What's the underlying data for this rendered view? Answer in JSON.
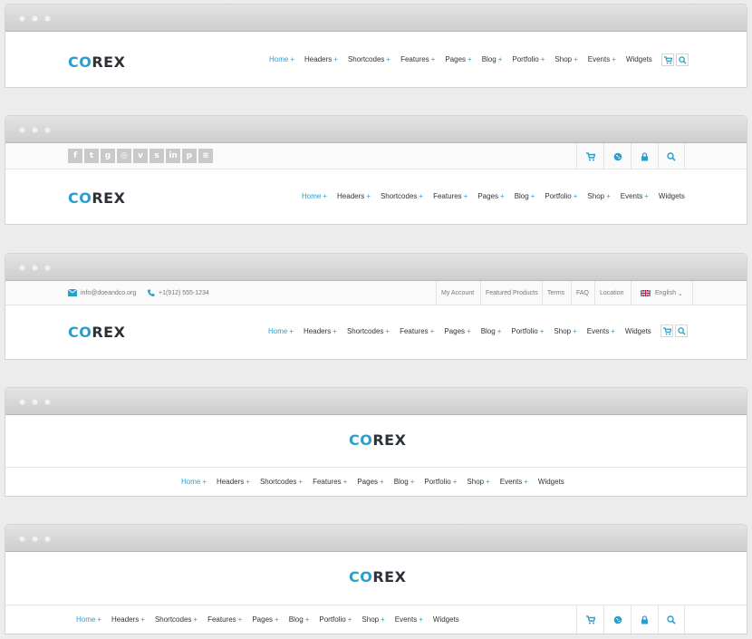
{
  "brand": {
    "logo_co": "CO",
    "logo_rex": "REX"
  },
  "nav": [
    {
      "label": "Home",
      "plus": "+",
      "active": true
    },
    {
      "label": "Headers",
      "plus": "+"
    },
    {
      "label": "Shortcodes",
      "plus": "+"
    },
    {
      "label": "Features",
      "plus": "+"
    },
    {
      "label": "Pages",
      "plus": "+"
    },
    {
      "label": "Blog",
      "plus": "+"
    },
    {
      "label": "Portfolio",
      "plus": "+"
    },
    {
      "label": "Shop",
      "plus": "+"
    },
    {
      "label": "Events",
      "plus": "+"
    },
    {
      "label": "Widgets",
      "plus": ""
    }
  ],
  "contact": {
    "email": "info@doeandco.org",
    "phone": "+1(912) 555-1234"
  },
  "top_links": [
    "My Account",
    "Featured Products",
    "Terms",
    "FAQ",
    "Location"
  ],
  "language": {
    "label": "English",
    "caret": "⌄"
  },
  "social_icons": [
    "facebook-icon",
    "twitter-icon",
    "google-plus-icon",
    "dribbble-icon",
    "vimeo-icon",
    "skype-icon",
    "linkedin-icon",
    "pinterest-icon",
    "rss-icon"
  ],
  "social_glyphs": [
    "f",
    "t",
    "g",
    "◎",
    "v",
    "s",
    "in",
    "p",
    "≋"
  ],
  "colors": {
    "accent": "#2a9fcc",
    "dark": "#2d3138",
    "muted": "#c9c9c9"
  }
}
